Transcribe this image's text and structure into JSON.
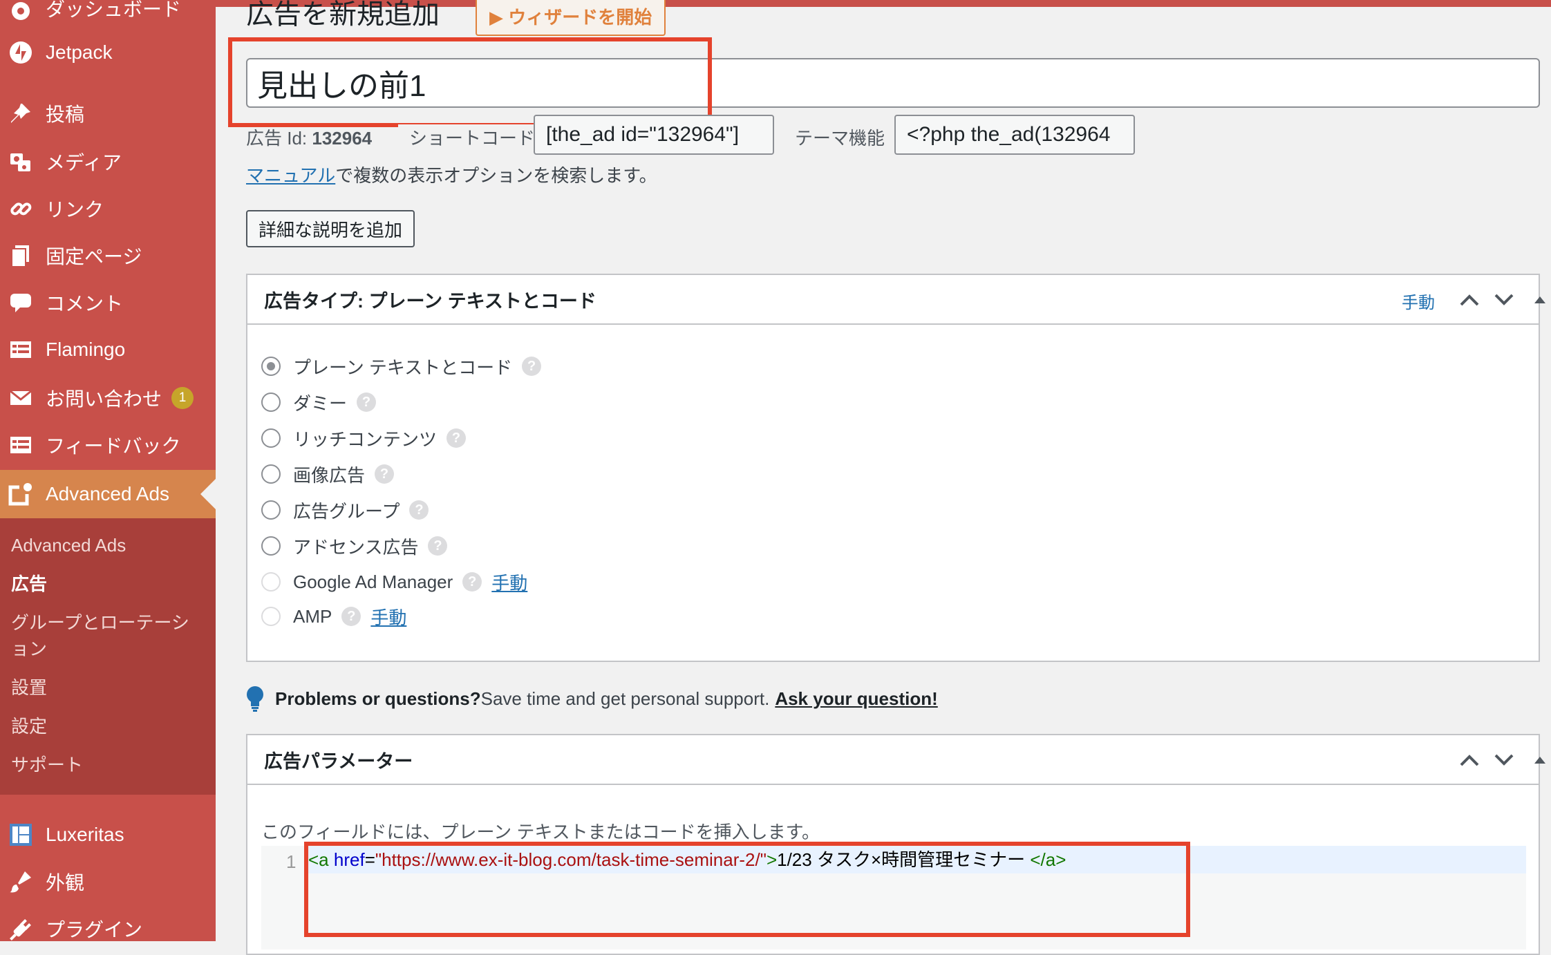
{
  "sidebar": {
    "items": [
      {
        "icon": "dashboard-icon",
        "label": "ダッシュボード"
      },
      {
        "icon": "jetpack-icon",
        "label": "Jetpack"
      },
      {
        "icon": "pin-icon",
        "label": "投稿"
      },
      {
        "icon": "media-icon",
        "label": "メディア"
      },
      {
        "icon": "link-icon",
        "label": "リンク"
      },
      {
        "icon": "pages-icon",
        "label": "固定ページ"
      },
      {
        "icon": "comment-icon",
        "label": "コメント"
      },
      {
        "icon": "flamingo-icon",
        "label": "Flamingo"
      },
      {
        "icon": "mail-icon",
        "label": "お問い合わせ",
        "badge": "1"
      },
      {
        "icon": "feedback-icon",
        "label": "フィードバック"
      },
      {
        "icon": "advanced-ads-icon",
        "label": "Advanced Ads",
        "active": true
      },
      {
        "icon": "luxeritas-icon",
        "label": "Luxeritas"
      },
      {
        "icon": "appearance-icon",
        "label": "外観"
      },
      {
        "icon": "plugin-icon",
        "label": "プラグイン"
      }
    ],
    "submenu": [
      {
        "label": "Advanced Ads"
      },
      {
        "label": "広告",
        "current": true
      },
      {
        "label": "グループとローテーション"
      },
      {
        "label": "設置"
      },
      {
        "label": "設定"
      },
      {
        "label": "サポート"
      }
    ]
  },
  "header": {
    "page_title": "広告を新規追加",
    "wizard_label": "▶ ウィザードを開始"
  },
  "ad_title": "見出しの前1",
  "meta": {
    "ad_id_label": "広告 Id:",
    "ad_id": "132964",
    "shortcode_label": "ショートコード",
    "shortcode_value": "[the_ad id=\"132964\"]",
    "theme_label": "テーマ機能",
    "theme_value": "<?php the_ad(132964"
  },
  "hint": {
    "link": "マニュアル",
    "text": "で複数の表示オプションを検索します。"
  },
  "add_description_label": "詳細な説明を追加",
  "ad_type_box": {
    "title": "広告タイプ: プレーン テキストとコード",
    "manual_link": "手動",
    "options": [
      {
        "label": "プレーン テキストとコード",
        "checked": true
      },
      {
        "label": "ダミー"
      },
      {
        "label": "リッチコンテンツ"
      },
      {
        "label": "画像広告"
      },
      {
        "label": "広告グループ"
      },
      {
        "label": "アドセンス広告"
      },
      {
        "label": "Google Ad Manager",
        "disabled": true,
        "link": "手動"
      },
      {
        "label": "AMP",
        "disabled": true,
        "link": "手動"
      }
    ]
  },
  "support": {
    "bold": "Problems or questions?",
    "text": " Save time and get personal support.",
    "link": "Ask your question!"
  },
  "params_box": {
    "title": "広告パラメーター",
    "description": "このフィールドには、プレーン テキストまたはコードを挿入します。",
    "line_number": "1",
    "code": {
      "open_tag": "<a",
      "attr": "href",
      "eq": "=",
      "url": "\"https://www.ex-it-blog.com/task-time-seminar-2/\"",
      "gt": ">",
      "text": "1/23 タスク×時間管理セミナー ",
      "close_tag": "</a>"
    }
  },
  "colors": {
    "sidebar_bg": "#c8504a",
    "sidebar_active": "#d6854d",
    "submenu_bg": "#a83f3a",
    "highlight_red": "#e5432c",
    "link_blue": "#2271b1"
  }
}
